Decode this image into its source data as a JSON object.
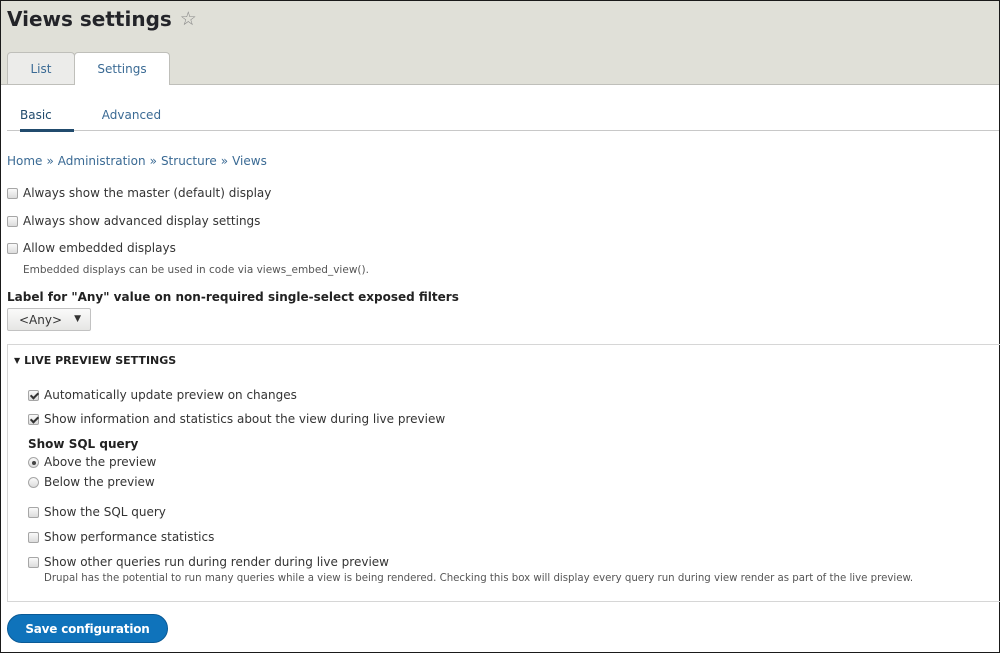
{
  "header": {
    "title": "Views settings",
    "star_icon": "star-outline-icon",
    "primary_tabs": [
      {
        "label": "List",
        "active": false
      },
      {
        "label": "Settings",
        "active": true
      }
    ]
  },
  "secondary_tabs": [
    {
      "label": "Basic",
      "active": true
    },
    {
      "label": "Advanced",
      "active": false
    }
  ],
  "breadcrumb": {
    "items": [
      "Home",
      "Administration",
      "Structure",
      "Views"
    ],
    "separator": "»"
  },
  "basic_options": [
    {
      "label": "Always show the master (default) display",
      "checked": false
    },
    {
      "label": "Always show advanced display settings",
      "checked": false
    },
    {
      "label": "Allow embedded displays",
      "checked": false,
      "description": "Embedded displays can be used in code via views_embed_view()."
    }
  ],
  "any_label": {
    "label": "Label for \"Any\" value on non-required single-select exposed filters",
    "selected": "<Any>"
  },
  "live_preview": {
    "legend": "LIVE PREVIEW SETTINGS",
    "expanded": true,
    "options": [
      {
        "label": "Automatically update preview on changes",
        "checked": true
      },
      {
        "label": "Show information and statistics about the view during live preview",
        "checked": true
      }
    ],
    "sql_query": {
      "label": "Show SQL query",
      "radios": [
        {
          "label": "Above the preview",
          "checked": true
        },
        {
          "label": "Below the preview",
          "checked": false
        }
      ]
    },
    "more_options": [
      {
        "label": "Show the SQL query",
        "checked": false
      },
      {
        "label": "Show performance statistics",
        "checked": false
      },
      {
        "label": "Show other queries run during render during live preview",
        "checked": false,
        "description": "Drupal has the potential to run many queries while a view is being rendered. Checking this box will display every query run during view render as part of the live preview."
      }
    ]
  },
  "actions": {
    "save_label": "Save configuration"
  },
  "colors": {
    "link": "#3a6a94",
    "header_bg": "#e0e0d8",
    "primary_button": "#0f73bb"
  }
}
